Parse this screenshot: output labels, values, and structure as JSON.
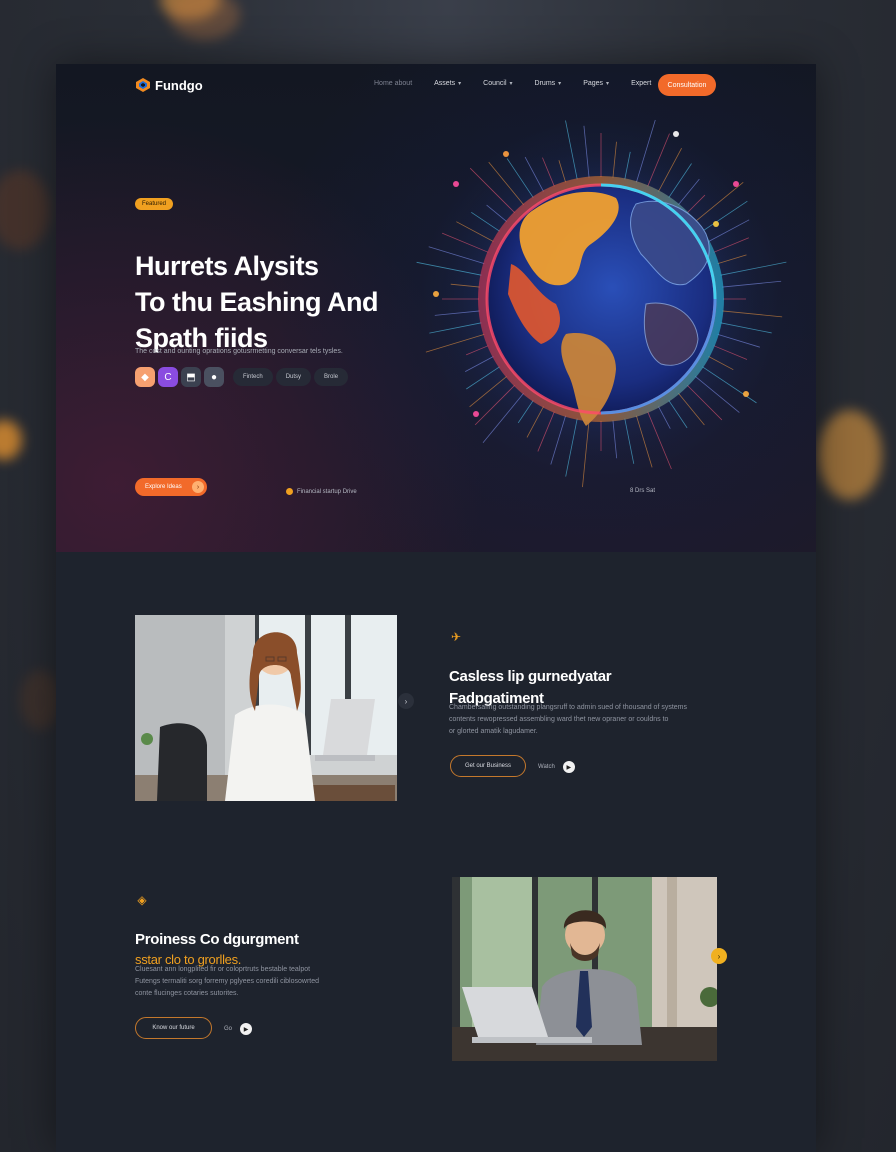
{
  "nav": {
    "logo": "Fundgo",
    "items": [
      {
        "label": "Home about",
        "dropdown": false,
        "dim": true
      },
      {
        "label": "Assets",
        "dropdown": true,
        "dim": false
      },
      {
        "label": "Council",
        "dropdown": true,
        "dim": false
      },
      {
        "label": "Drums",
        "dropdown": true,
        "dim": false
      },
      {
        "label": "Pages",
        "dropdown": true,
        "dim": false
      },
      {
        "label": "Expert",
        "dropdown": false,
        "dim": false
      }
    ],
    "cta": "Consultation"
  },
  "hero": {
    "tag": "Featured",
    "headline": [
      "Hurrets Alysits",
      "To thu Eashing And",
      "Spath fiids"
    ],
    "subline": "The cost and ounting oprations gotusrmetting conversar tels tysles.",
    "chips": [
      "Fintech",
      "Dutsy",
      "Brole"
    ],
    "cta": "Explore Ideas",
    "meta_left": "Financial startup Drive",
    "meta_right": "8 Drs Sat"
  },
  "feature1": {
    "title": [
      "Casless lip gurnedyatar",
      "Fadpgatiment"
    ],
    "body": [
      "Chambersafing outstanding plangsruff to admin sued of thousand of systems",
      "contents rewopressed assembling ward thet new opraner or couldns to",
      "or glorted amatik lagudamer."
    ],
    "button": "Get our Business",
    "link": "Watch"
  },
  "feature2": {
    "title": "Proiness Co dgurgment",
    "subtitle": "sstar clo to grorlles.",
    "body": [
      "Cluesant ann longplited fir or coloprtruts bestable tealpot",
      "Futengs termaliti sorg forremy pglyees coredili ciblosowrted",
      "conte flucinges cotaries sutorites."
    ],
    "button": "Know our future",
    "link": "Go"
  },
  "colors": {
    "accent": "#f26a2a",
    "accent_yellow": "#f0a020",
    "panel": "#1e232d",
    "hero_bg": "#131722"
  }
}
